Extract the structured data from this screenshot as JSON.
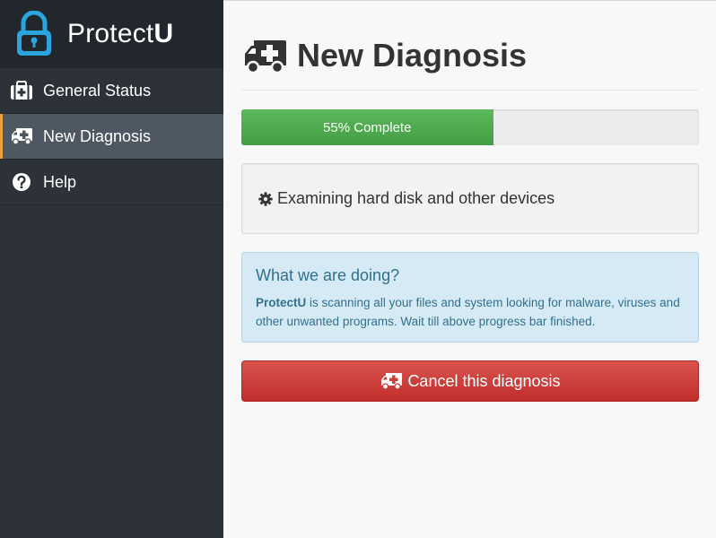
{
  "brand": {
    "name_prefix": "Protect",
    "name_bold": "U",
    "icon": "padlock-icon"
  },
  "sidebar": {
    "items": [
      {
        "label": "General Status",
        "icon": "medkit-icon",
        "active": false
      },
      {
        "label": "New Diagnosis",
        "icon": "ambulance-icon",
        "active": true
      },
      {
        "label": "Help",
        "icon": "question-circle-icon",
        "active": false
      }
    ]
  },
  "main": {
    "title": "New Diagnosis",
    "title_icon": "ambulance-icon",
    "progress": {
      "label": "55% Complete",
      "percent": 55,
      "color": "#5cb85c"
    },
    "status": {
      "icon": "gear-icon",
      "text": "Examining hard disk and other devices"
    },
    "info": {
      "title": "What we are doing?",
      "text_bold": "ProtectU",
      "text_rest": " is scanning all your files and system looking for malware, viruses and other unwanted programs. Wait till above progress bar finished."
    },
    "cancel_button": {
      "label": "Cancel this diagnosis",
      "icon": "ambulance-icon",
      "color": "#d9534f"
    }
  },
  "colors": {
    "sidebar": "#2d3239",
    "brand_bg": "#22272d",
    "active_item": "#4e5862",
    "accent": "#e8a33d",
    "brand_icon": "#2aa5e0"
  }
}
